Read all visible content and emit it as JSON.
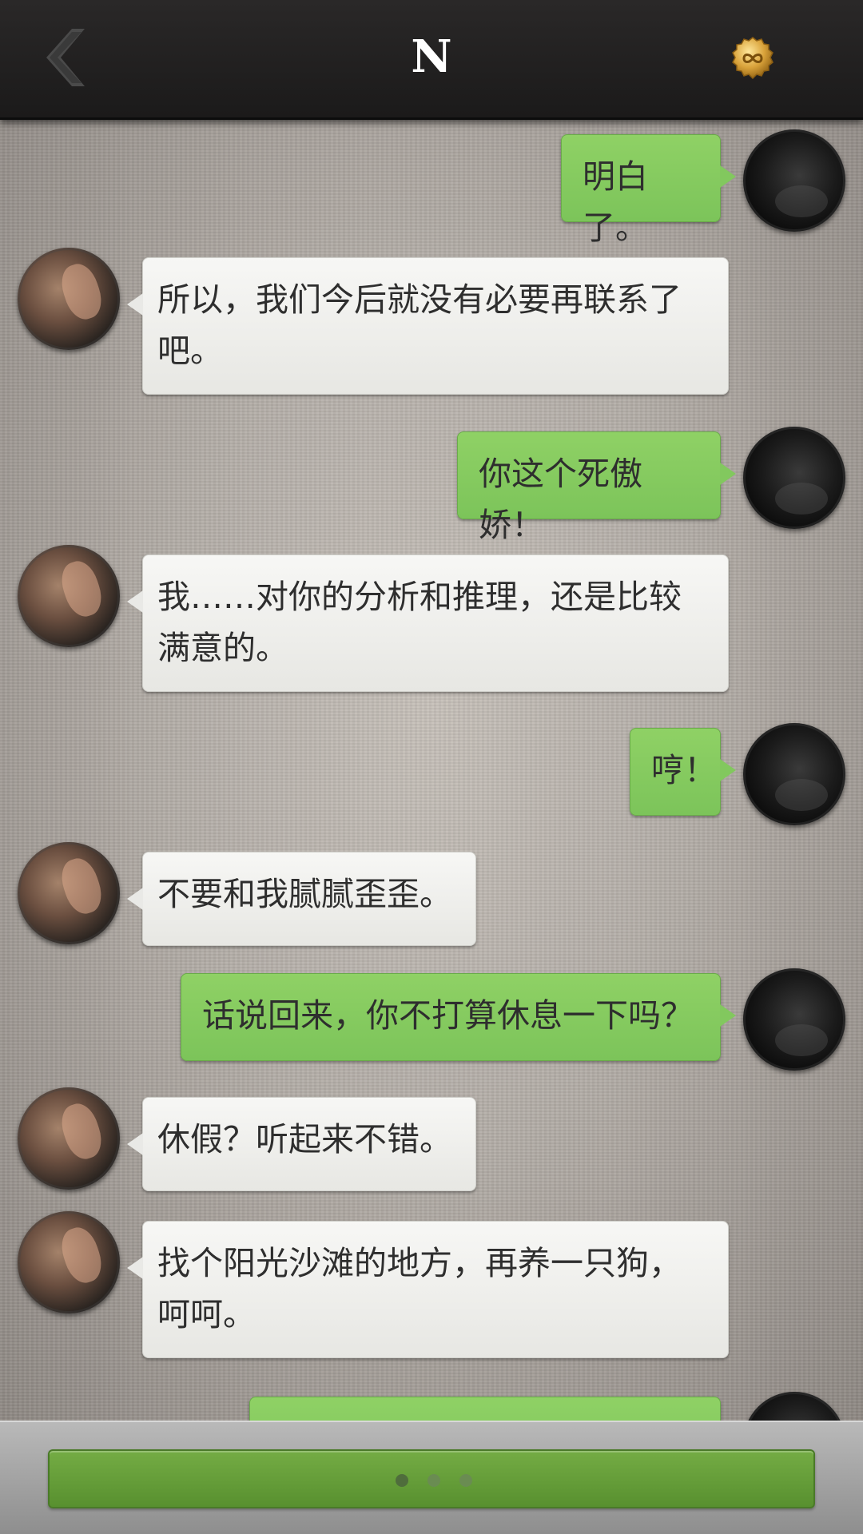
{
  "header": {
    "title": "N",
    "back_icon": "chevron-left-icon",
    "right_icon": "gold-coin-infinity-icon"
  },
  "messages": [
    {
      "side": "right",
      "text": "明白了。"
    },
    {
      "side": "left",
      "text": "所以，我们今后就没有必要再联系了吧。"
    },
    {
      "side": "right",
      "text": "你这个死傲娇！"
    },
    {
      "side": "left",
      "text": "我……对你的分析和推理，还是比较满意的。"
    },
    {
      "side": "right",
      "text": "哼！"
    },
    {
      "side": "left",
      "text": "不要和我腻腻歪歪。"
    },
    {
      "side": "right",
      "text": "话说回来，你不打算休息一下吗？"
    },
    {
      "side": "left",
      "text": "休假？听起来不错。"
    },
    {
      "side": "left",
      "text": "找个阳光沙滩的地方，再养一只狗，呵呵。"
    },
    {
      "side": "right",
      "text": ""
    }
  ],
  "footer": {
    "reply_button_icon": "ellipsis-dots-icon"
  },
  "colors": {
    "header_bg": "#1f1e1e",
    "bubble_green": "#86cb5f",
    "bubble_white": "#f0f0ee",
    "reply_button": "#65a03a"
  }
}
